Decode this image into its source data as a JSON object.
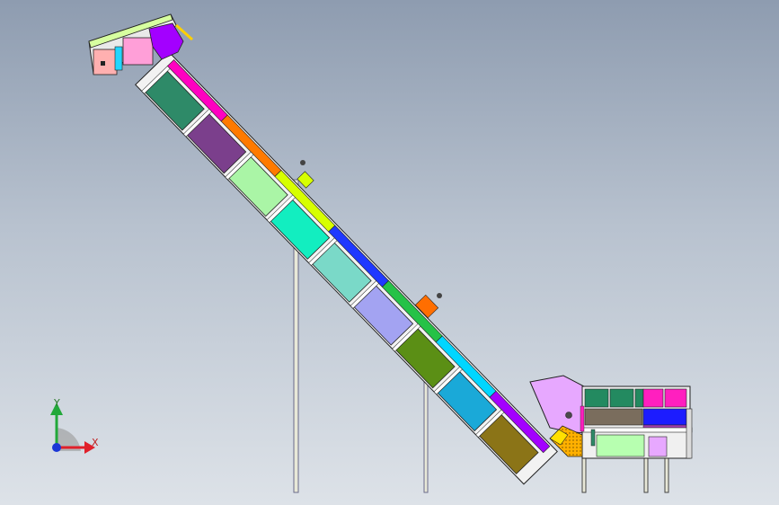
{
  "triad": {
    "x_label": "X",
    "y_label": "Y",
    "x_color": "#e0202a",
    "y_color": "#22a83a",
    "z_color": "#1b36d6"
  },
  "palette": {
    "panel_colors": [
      "#2e8a68",
      "#7b3f8c",
      "#aaf5a6",
      "#12eec0",
      "#7ad9c8",
      "#a3a3f2",
      "#5b8f15",
      "#1aa9d8",
      "#8b7417"
    ],
    "rail_colors": [
      "#ff00c0",
      "#ff7a00",
      "#d7ff00",
      "#1f38ff",
      "#25c247",
      "#00d6ff",
      "#a300ff"
    ],
    "head_colors": [
      "#d7ffa0",
      "#ff9fd8",
      "#a300ff",
      "#ffb0b0",
      "#22d6ff"
    ],
    "tail_colors": [
      "#e7a8ff",
      "#238a60",
      "#ff1fbf",
      "#1c1cff",
      "#a33fb0",
      "#7a6d5d",
      "#b7ffb0",
      "#ffb000"
    ],
    "support_color": "#e8e8d8"
  }
}
